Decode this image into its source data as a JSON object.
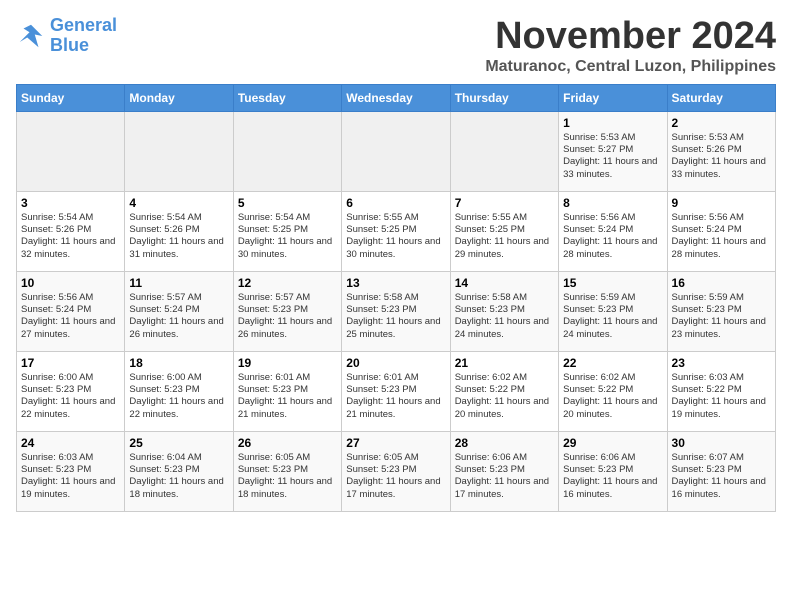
{
  "header": {
    "logo_line1": "General",
    "logo_line2": "Blue",
    "month": "November 2024",
    "location": "Maturanoc, Central Luzon, Philippines"
  },
  "days_of_week": [
    "Sunday",
    "Monday",
    "Tuesday",
    "Wednesday",
    "Thursday",
    "Friday",
    "Saturday"
  ],
  "weeks": [
    [
      {
        "day": "",
        "info": ""
      },
      {
        "day": "",
        "info": ""
      },
      {
        "day": "",
        "info": ""
      },
      {
        "day": "",
        "info": ""
      },
      {
        "day": "",
        "info": ""
      },
      {
        "day": "1",
        "info": "Sunrise: 5:53 AM\nSunset: 5:27 PM\nDaylight: 11 hours and 33 minutes."
      },
      {
        "day": "2",
        "info": "Sunrise: 5:53 AM\nSunset: 5:26 PM\nDaylight: 11 hours and 33 minutes."
      }
    ],
    [
      {
        "day": "3",
        "info": "Sunrise: 5:54 AM\nSunset: 5:26 PM\nDaylight: 11 hours and 32 minutes."
      },
      {
        "day": "4",
        "info": "Sunrise: 5:54 AM\nSunset: 5:26 PM\nDaylight: 11 hours and 31 minutes."
      },
      {
        "day": "5",
        "info": "Sunrise: 5:54 AM\nSunset: 5:25 PM\nDaylight: 11 hours and 30 minutes."
      },
      {
        "day": "6",
        "info": "Sunrise: 5:55 AM\nSunset: 5:25 PM\nDaylight: 11 hours and 30 minutes."
      },
      {
        "day": "7",
        "info": "Sunrise: 5:55 AM\nSunset: 5:25 PM\nDaylight: 11 hours and 29 minutes."
      },
      {
        "day": "8",
        "info": "Sunrise: 5:56 AM\nSunset: 5:24 PM\nDaylight: 11 hours and 28 minutes."
      },
      {
        "day": "9",
        "info": "Sunrise: 5:56 AM\nSunset: 5:24 PM\nDaylight: 11 hours and 28 minutes."
      }
    ],
    [
      {
        "day": "10",
        "info": "Sunrise: 5:56 AM\nSunset: 5:24 PM\nDaylight: 11 hours and 27 minutes."
      },
      {
        "day": "11",
        "info": "Sunrise: 5:57 AM\nSunset: 5:24 PM\nDaylight: 11 hours and 26 minutes."
      },
      {
        "day": "12",
        "info": "Sunrise: 5:57 AM\nSunset: 5:23 PM\nDaylight: 11 hours and 26 minutes."
      },
      {
        "day": "13",
        "info": "Sunrise: 5:58 AM\nSunset: 5:23 PM\nDaylight: 11 hours and 25 minutes."
      },
      {
        "day": "14",
        "info": "Sunrise: 5:58 AM\nSunset: 5:23 PM\nDaylight: 11 hours and 24 minutes."
      },
      {
        "day": "15",
        "info": "Sunrise: 5:59 AM\nSunset: 5:23 PM\nDaylight: 11 hours and 24 minutes."
      },
      {
        "day": "16",
        "info": "Sunrise: 5:59 AM\nSunset: 5:23 PM\nDaylight: 11 hours and 23 minutes."
      }
    ],
    [
      {
        "day": "17",
        "info": "Sunrise: 6:00 AM\nSunset: 5:23 PM\nDaylight: 11 hours and 22 minutes."
      },
      {
        "day": "18",
        "info": "Sunrise: 6:00 AM\nSunset: 5:23 PM\nDaylight: 11 hours and 22 minutes."
      },
      {
        "day": "19",
        "info": "Sunrise: 6:01 AM\nSunset: 5:23 PM\nDaylight: 11 hours and 21 minutes."
      },
      {
        "day": "20",
        "info": "Sunrise: 6:01 AM\nSunset: 5:23 PM\nDaylight: 11 hours and 21 minutes."
      },
      {
        "day": "21",
        "info": "Sunrise: 6:02 AM\nSunset: 5:22 PM\nDaylight: 11 hours and 20 minutes."
      },
      {
        "day": "22",
        "info": "Sunrise: 6:02 AM\nSunset: 5:22 PM\nDaylight: 11 hours and 20 minutes."
      },
      {
        "day": "23",
        "info": "Sunrise: 6:03 AM\nSunset: 5:22 PM\nDaylight: 11 hours and 19 minutes."
      }
    ],
    [
      {
        "day": "24",
        "info": "Sunrise: 6:03 AM\nSunset: 5:23 PM\nDaylight: 11 hours and 19 minutes."
      },
      {
        "day": "25",
        "info": "Sunrise: 6:04 AM\nSunset: 5:23 PM\nDaylight: 11 hours and 18 minutes."
      },
      {
        "day": "26",
        "info": "Sunrise: 6:05 AM\nSunset: 5:23 PM\nDaylight: 11 hours and 18 minutes."
      },
      {
        "day": "27",
        "info": "Sunrise: 6:05 AM\nSunset: 5:23 PM\nDaylight: 11 hours and 17 minutes."
      },
      {
        "day": "28",
        "info": "Sunrise: 6:06 AM\nSunset: 5:23 PM\nDaylight: 11 hours and 17 minutes."
      },
      {
        "day": "29",
        "info": "Sunrise: 6:06 AM\nSunset: 5:23 PM\nDaylight: 11 hours and 16 minutes."
      },
      {
        "day": "30",
        "info": "Sunrise: 6:07 AM\nSunset: 5:23 PM\nDaylight: 11 hours and 16 minutes."
      }
    ]
  ]
}
